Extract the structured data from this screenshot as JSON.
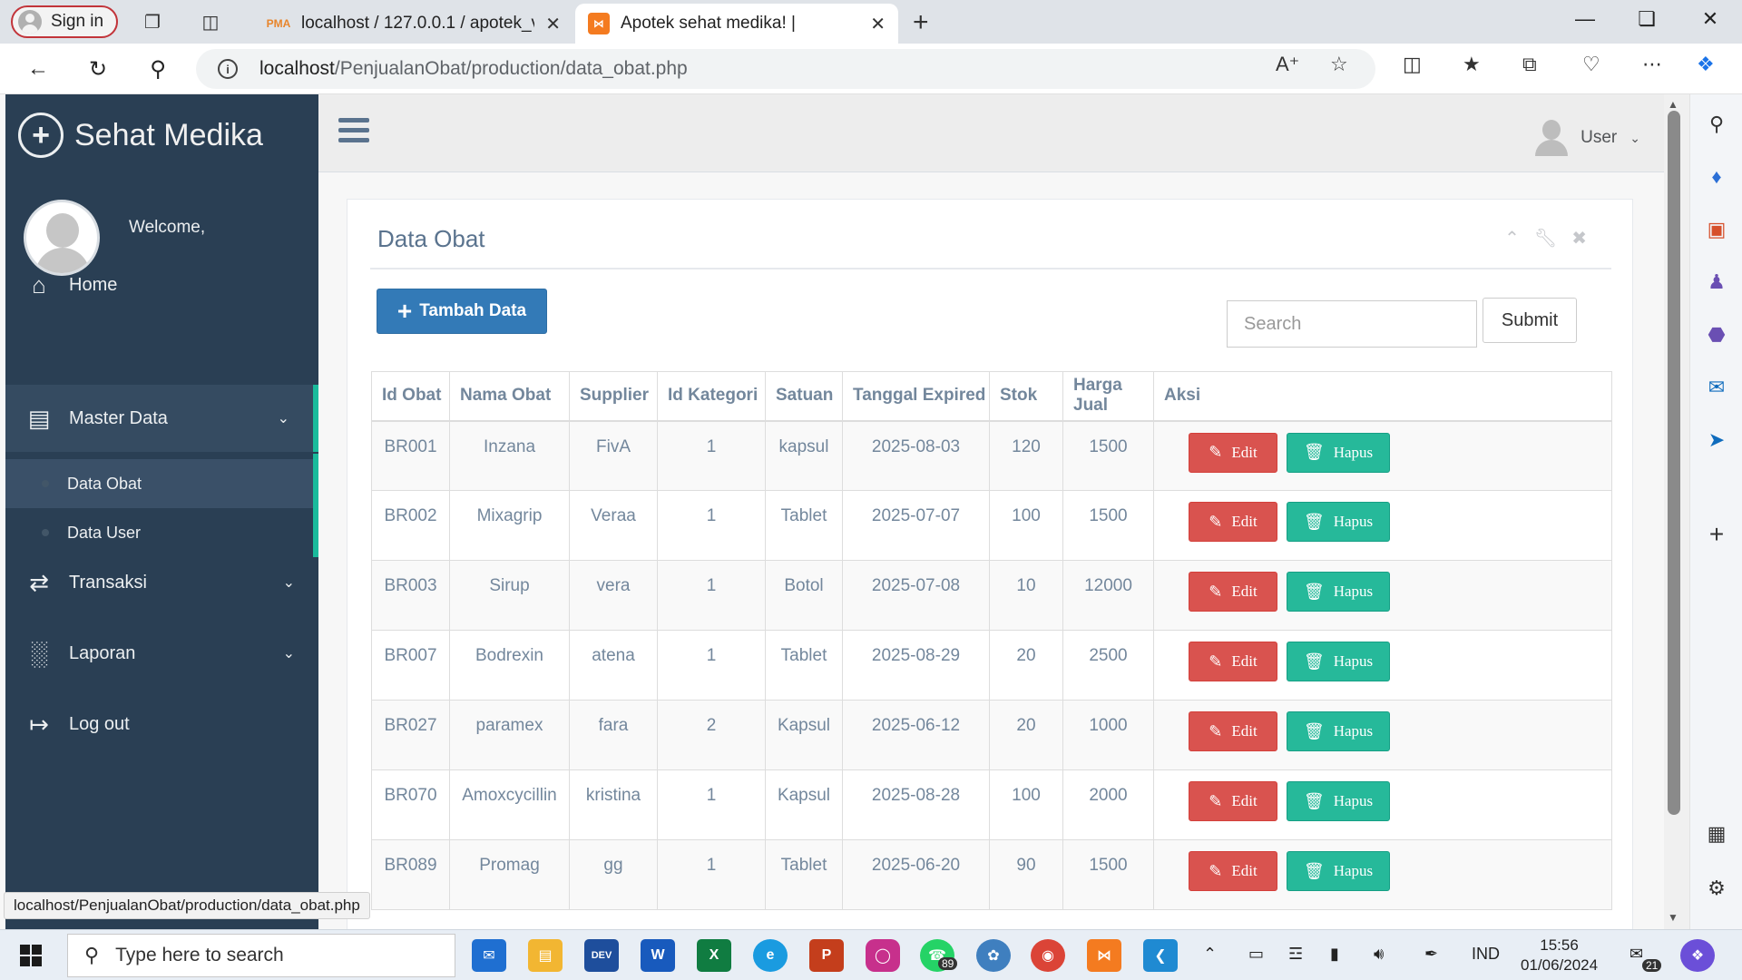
{
  "browser": {
    "signin_label": "Sign in",
    "tabs": [
      {
        "title": "localhost / 127.0.0.1 / apotek_ver",
        "favicon": "PMA"
      },
      {
        "title": "Apotek sehat medika! |",
        "favicon": "xampp-icon"
      }
    ],
    "url_host": "localhost",
    "url_path": "/PenjualanObat/production/data_obat.php"
  },
  "sidebar": {
    "brand": "Sehat Medika",
    "welcome": "Welcome,",
    "menu": {
      "home": "Home",
      "master_data": "Master Data",
      "data_obat": "Data Obat",
      "data_user": "Data User",
      "transaksi": "Transaksi",
      "laporan": "Laporan",
      "logout": "Log out"
    }
  },
  "topnav": {
    "user_label": "User"
  },
  "panel": {
    "title": "Data Obat",
    "add_button": "Tambah Data",
    "search_placeholder": "Search",
    "submit_label": "Submit",
    "columns": [
      "Id Obat",
      "Nama Obat",
      "Supplier",
      "Id Kategori",
      "Satuan",
      "Tanggal Expired",
      "Stok",
      "Harga Jual",
      "Aksi"
    ],
    "edit_label": "Edit",
    "delete_label": "Hapus",
    "rows": [
      [
        "BR001",
        "Inzana",
        "FivA",
        "1",
        "kapsul",
        "2025-08-03",
        "120",
        "1500"
      ],
      [
        "BR002",
        "Mixagrip",
        "Veraa",
        "1",
        "Tablet",
        "2025-07-07",
        "100",
        "1500"
      ],
      [
        "BR003",
        "Sirup",
        "vera",
        "1",
        "Botol",
        "2025-07-08",
        "10",
        "12000"
      ],
      [
        "BR007",
        "Bodrexin",
        "atena",
        "1",
        "Tablet",
        "2025-08-29",
        "20",
        "2500"
      ],
      [
        "BR027",
        "paramex",
        "fara",
        "2",
        "Kapsul",
        "2025-06-12",
        "20",
        "1000"
      ],
      [
        "BR070",
        "Amoxcycillin",
        "kristina",
        "1",
        "Kapsul",
        "2025-08-28",
        "100",
        "2000"
      ],
      [
        "BR089",
        "Promag",
        "gg",
        "1",
        "Tablet",
        "2025-06-20",
        "90",
        "1500"
      ]
    ]
  },
  "status_url": "localhost/PenjualanObat/production/data_obat.php",
  "taskbar": {
    "search_placeholder": "Type here to search",
    "whatsapp_badge": "89",
    "language": "IND",
    "time": "15:56",
    "date": "01/06/2024",
    "notification_count": "21"
  },
  "colors": {
    "sidebar_bg": "#2a3f54",
    "accent_green": "#1abb9c",
    "primary_blue": "#337ab7",
    "danger_red": "#d9534f",
    "success_teal": "#26b99a"
  }
}
